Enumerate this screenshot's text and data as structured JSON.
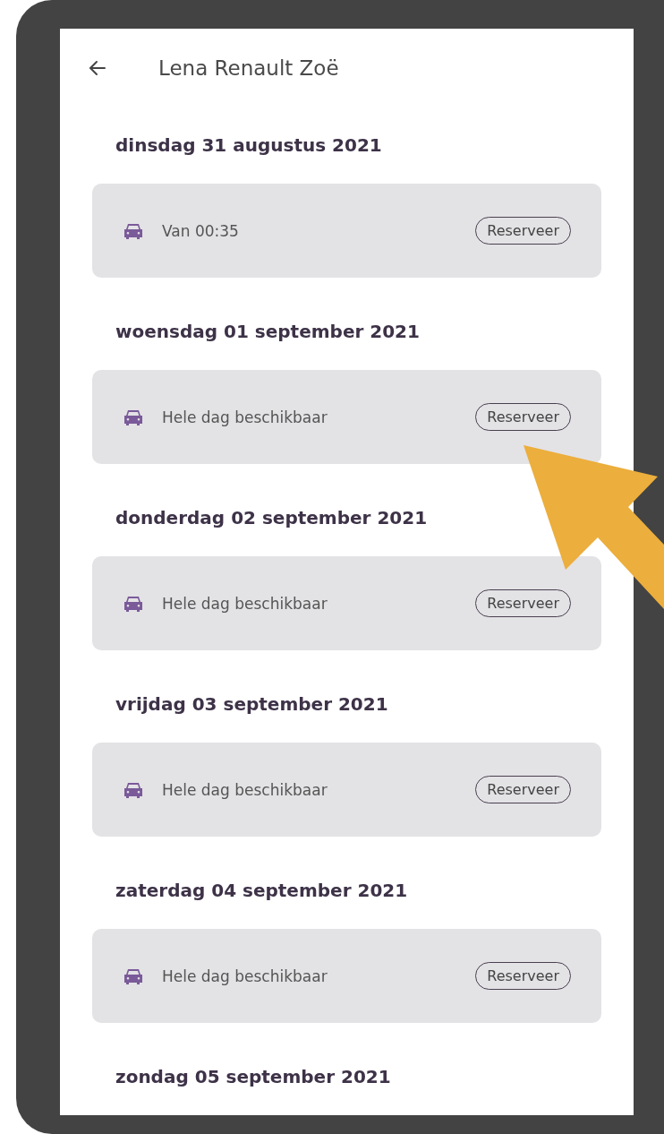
{
  "header": {
    "title": "Lena Renault Zoë"
  },
  "days": [
    {
      "date": "dinsdag 31 augustus 2021",
      "availability": "Van 00:35",
      "button": "Reserveer"
    },
    {
      "date": "woensdag 01 september 2021",
      "availability": "Hele dag beschikbaar",
      "button": "Reserveer"
    },
    {
      "date": "donderdag 02 september 2021",
      "availability": "Hele dag beschikbaar",
      "button": "Reserveer"
    },
    {
      "date": "vrijdag 03 september 2021",
      "availability": "Hele dag beschikbaar",
      "button": "Reserveer"
    },
    {
      "date": "zaterdag 04 september 2021",
      "availability": "Hele dag beschikbaar",
      "button": "Reserveer"
    },
    {
      "date": "zondag 05 september 2021"
    }
  ]
}
